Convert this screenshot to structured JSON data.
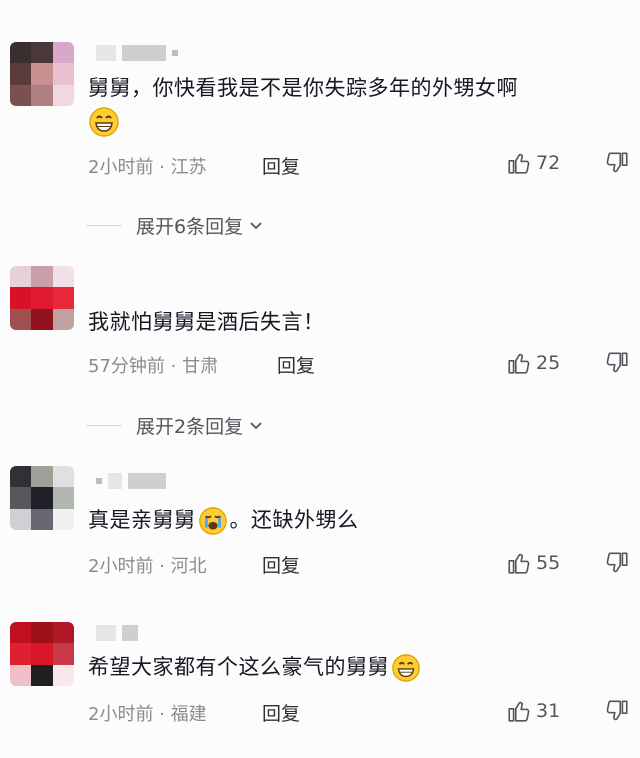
{
  "comments": [
    {
      "text": "舅舅，你快看我是不是你失踪多年的外甥女啊",
      "time": "2小时前",
      "location": "江苏",
      "reply_label": "回复",
      "likes": "72",
      "expand_label": "展开6条回复",
      "emoji": "grin-emoji"
    },
    {
      "text": "我就怕舅舅是酒后失言！",
      "time": "57分钟前",
      "location": "甘肃",
      "reply_label": "回复",
      "likes": "25",
      "expand_label": "展开2条回复"
    },
    {
      "text_before": "真是亲舅舅",
      "text_after": "。还缺外甥么",
      "time": "2小时前",
      "location": "河北",
      "reply_label": "回复",
      "likes": "55",
      "emoji": "crying-emoji"
    },
    {
      "text": "希望大家都有个这么豪气的舅舅",
      "time": "2小时前",
      "location": "福建",
      "reply_label": "回复",
      "likes": "31",
      "emoji": "grin-emoji"
    }
  ],
  "meta_separator": " · ",
  "colors": {
    "text": "#161823",
    "meta": "#8a8b91",
    "background": "#fcfcfc"
  }
}
